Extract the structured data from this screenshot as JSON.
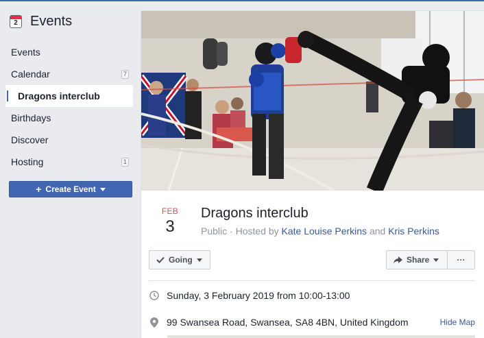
{
  "sidebar": {
    "title": "Events",
    "calendar_icon_day": "2",
    "items": [
      {
        "label": "Events",
        "badge": ""
      },
      {
        "label": "Calendar",
        "badge": "7"
      },
      {
        "label": "Dragons interclub",
        "badge": ""
      },
      {
        "label": "Birthdays",
        "badge": ""
      },
      {
        "label": "Discover",
        "badge": ""
      },
      {
        "label": "Hosting",
        "badge": "1"
      }
    ],
    "active_item": "Dragons interclub",
    "create_button_label": "Create Event"
  },
  "event": {
    "date_month": "FEB",
    "date_day": "3",
    "title": "Dragons interclub",
    "privacy": "Public",
    "hosted_by_prefix": "Hosted by",
    "host_1": "Kate Louise Perkins",
    "host_joiner": "and",
    "host_2": "Kris Perkins",
    "cover_image": "kickboxing-sparring-photo"
  },
  "actions": {
    "going_label": "Going",
    "share_label": "Share",
    "more_label": "···"
  },
  "details": {
    "time": "Sunday, 3 February 2019 from 10:00-13:00",
    "location": "99 Swansea Road, Swansea, SA8 4BN, United Kingdom",
    "hide_map_label": "Hide Map"
  },
  "colors": {
    "brand_blue": "#4267b2",
    "link_blue": "#385898",
    "date_red": "#f3425f"
  }
}
